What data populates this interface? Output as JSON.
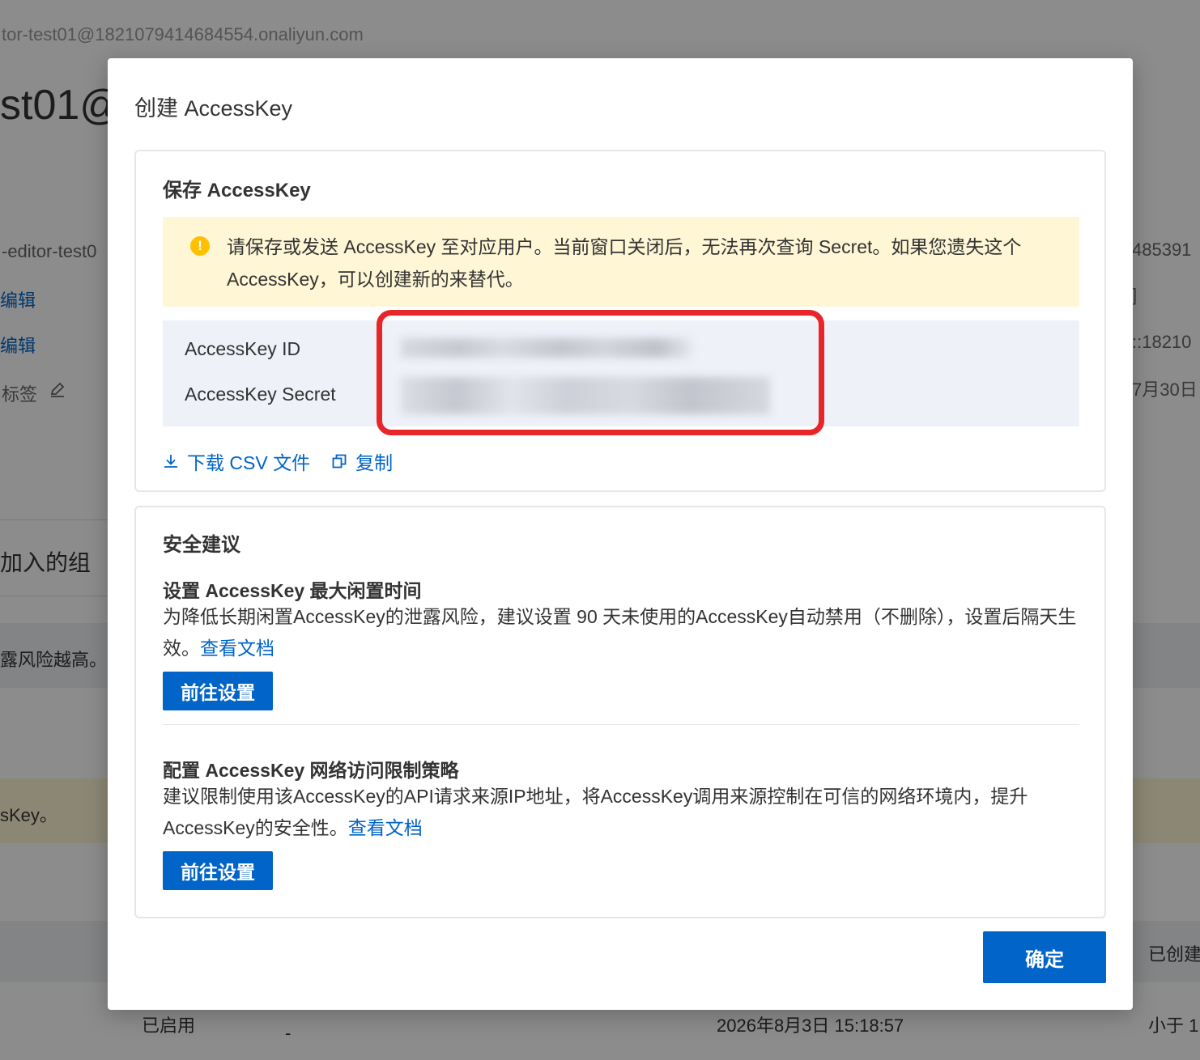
{
  "background": {
    "domain": "tor-test01@1821079414684554.onaliyun.com",
    "title": "st01@",
    "left_field": "-editor-test0",
    "edit_1": "编辑",
    "edit_2": "编辑",
    "tag_label": "标签",
    "right_1": "485391",
    "right_2": "]",
    "right_3": "::18210",
    "right_4": "7月30日",
    "group_label": "加入的组",
    "risk_text": "露风险越高。",
    "key_text": "sKey。",
    "created_header": "已创建",
    "row": {
      "status": "已启用",
      "dash": "-",
      "date": "2026年8月3日 15:18:57",
      "less": "小于 1"
    }
  },
  "modal": {
    "title": "创建 AccessKey",
    "save_section": {
      "heading": "保存 AccessKey",
      "alert_text": "请保存或发送 AccessKey 至对应用户。当前窗口关闭后，无法再次查询 Secret。如果您遗失这个 AccessKey，可以创建新的来替代。",
      "id_label": "AccessKey ID",
      "secret_label": "AccessKey Secret",
      "download_label": "下载 CSV 文件",
      "copy_label": "复制"
    },
    "security_section": {
      "heading": "安全建议",
      "idle": {
        "title": "设置 AccessKey 最大闲置时间",
        "desc": "为降低长期闲置AccessKey的泄露风险，建议设置 90 天未使用的AccessKey自动禁用（不删除），设置后隔天生效。",
        "link": "查看文档",
        "button": "前往设置"
      },
      "network": {
        "title": "配置 AccessKey 网络访问限制策略",
        "desc": "建议限制使用该AccessKey的API请求来源IP地址，将AccessKey调用来源控制在可信的网络环境内，提升AccessKey的安全性。",
        "link": "查看文档",
        "button": "前往设置"
      }
    },
    "ok_button": "确定"
  },
  "colors": {
    "primary": "#0064c8",
    "warning_bg": "#fff6d6",
    "warning_icon": "#ffc000",
    "highlight": "#e8262a"
  },
  "icons": {
    "alert": "warning-circle-icon",
    "download": "download-icon",
    "copy": "copy-icon",
    "edit": "pencil-icon"
  }
}
